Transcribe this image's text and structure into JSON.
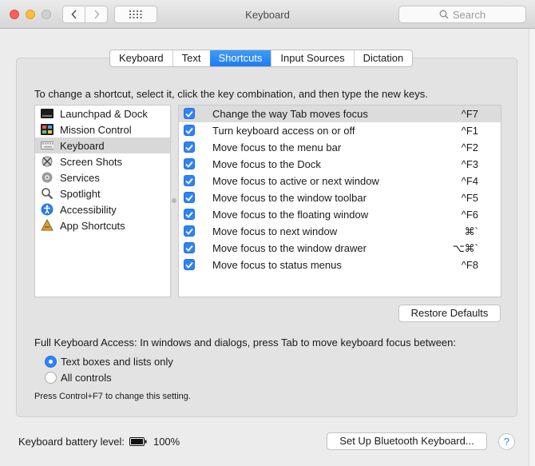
{
  "window": {
    "title": "Keyboard"
  },
  "toolbar": {
    "search_placeholder": "Search",
    "back_icon": "chevron-left-icon",
    "forward_icon": "chevron-right-icon",
    "grid_icon": "grid-icon"
  },
  "tabs": [
    {
      "label": "Keyboard",
      "active": false
    },
    {
      "label": "Text",
      "active": false
    },
    {
      "label": "Shortcuts",
      "active": true
    },
    {
      "label": "Input Sources",
      "active": false
    },
    {
      "label": "Dictation",
      "active": false
    }
  ],
  "instructions": "To change a shortcut, select it, click the key combination, and then type the new keys.",
  "categories": [
    {
      "label": "Launchpad & Dock",
      "icon": "launchpad-icon",
      "selected": false
    },
    {
      "label": "Mission Control",
      "icon": "mission-control-icon",
      "selected": false
    },
    {
      "label": "Keyboard",
      "icon": "keyboard-icon",
      "selected": true
    },
    {
      "label": "Screen Shots",
      "icon": "screenshot-icon",
      "selected": false
    },
    {
      "label": "Services",
      "icon": "services-gear-icon",
      "selected": false
    },
    {
      "label": "Spotlight",
      "icon": "spotlight-icon",
      "selected": false
    },
    {
      "label": "Accessibility",
      "icon": "accessibility-icon",
      "selected": false
    },
    {
      "label": "App Shortcuts",
      "icon": "app-shortcuts-icon",
      "selected": false
    }
  ],
  "shortcuts": [
    {
      "label": "Change the way Tab moves focus",
      "key": "^F7",
      "checked": true,
      "selected": true
    },
    {
      "label": "Turn keyboard access on or off",
      "key": "^F1",
      "checked": true,
      "selected": false
    },
    {
      "label": "Move focus to the menu bar",
      "key": "^F2",
      "checked": true,
      "selected": false
    },
    {
      "label": "Move focus to the Dock",
      "key": "^F3",
      "checked": true,
      "selected": false
    },
    {
      "label": "Move focus to active or next window",
      "key": "^F4",
      "checked": true,
      "selected": false
    },
    {
      "label": "Move focus to the window toolbar",
      "key": "^F5",
      "checked": true,
      "selected": false
    },
    {
      "label": "Move focus to the floating window",
      "key": "^F6",
      "checked": true,
      "selected": false
    },
    {
      "label": "Move focus to next window",
      "key": "⌘`",
      "checked": true,
      "selected": false
    },
    {
      "label": "Move focus to the window drawer",
      "key": "⌥⌘`",
      "checked": true,
      "selected": false
    },
    {
      "label": "Move focus to status menus",
      "key": "^F8",
      "checked": true,
      "selected": false
    }
  ],
  "restore_defaults": "Restore Defaults",
  "full_keyboard_access": {
    "label": "Full Keyboard Access: In windows and dialogs, press Tab to move keyboard focus between:",
    "options": [
      {
        "label": "Text boxes and lists only",
        "selected": true
      },
      {
        "label": "All controls",
        "selected": false
      }
    ],
    "hint": "Press Control+F7 to change this setting."
  },
  "battery": {
    "label": "Keyboard battery level:",
    "value": "100%",
    "level": 1.0
  },
  "bluetooth_button": "Set Up Bluetooth Keyboard...",
  "help": "?",
  "colors": {
    "accent": "#2f83f5",
    "close": "#fc605b",
    "minimize": "#fdbc40"
  }
}
